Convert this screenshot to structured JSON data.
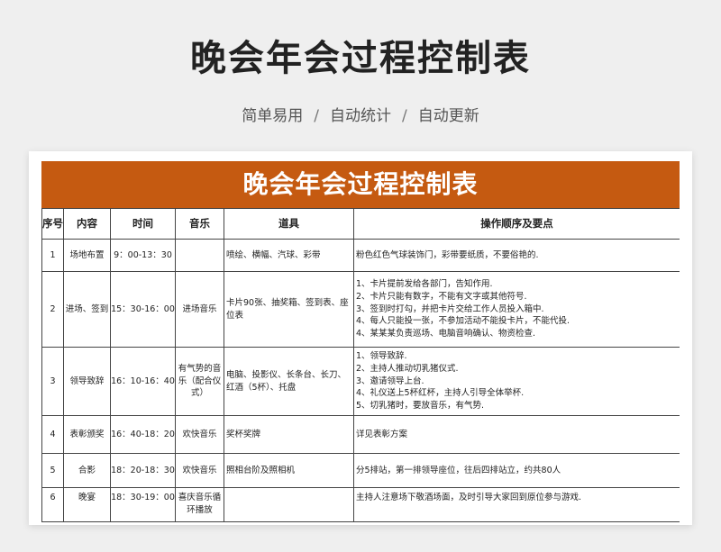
{
  "page": {
    "title": "晚会年会过程控制表",
    "subtitle": [
      "简单易用",
      "自动统计",
      "自动更新"
    ]
  },
  "sheet": {
    "banner": "晚会年会过程控制表",
    "headers": [
      "序号",
      "内容",
      "时间",
      "音乐",
      "道具",
      "操作顺序及要点"
    ],
    "rows": [
      {
        "no": "1",
        "content": "场地布置",
        "time": "9：00-13：30",
        "music": "",
        "props": "喷绘、横幅、汽球、彩带",
        "steps": [
          "粉色红色气球装饰门，彩带要纸质，不要俗艳的."
        ]
      },
      {
        "no": "2",
        "content": "进场、签到",
        "time": "15：30-16：00",
        "music": "进场音乐",
        "props": "卡片90张、抽奖箱、签到表、座位表",
        "steps": [
          "1、卡片提前发给各部门，告知作用.",
          "2、卡片只能有数字，不能有文字或其他符号.",
          "3、签到时打勾，并把卡片交给工作人员投入箱中.",
          "4、每人只能投一张，不参加活动不能投卡片，不能代投.",
          "4、某某某负责巡场、电脑音响确认、物资检查."
        ]
      },
      {
        "no": "3",
        "content": "领导致辞",
        "time": "16：10-16：40",
        "music": "有气势的音乐（配合仪式）",
        "props": "电脑、投影仪、长条台、长刀、红酒（5杯）、托盘",
        "steps": [
          "1、领导致辞.",
          "2、主持人推动切乳猪仪式.",
          "3、邀请领导上台.",
          "4、礼仪送上5杯红杯，主持人引导全体举杯.",
          "5、切乳猪时，要放音乐，有气势."
        ]
      },
      {
        "no": "4",
        "content": "表彰颁奖",
        "time": "16：40-18：20",
        "music": "欢快音乐",
        "props": "奖杯奖牌",
        "steps": [
          "详见表彰方案"
        ]
      },
      {
        "no": "5",
        "content": "合影",
        "time": "18：20-18：30",
        "music": "欢快音乐",
        "props": "照相台阶及照相机",
        "steps": [
          "分5排站，第一排领导座位，往后四排站立，约共80人"
        ]
      },
      {
        "no": "6",
        "content": "晚宴",
        "time": "18：30-19：00",
        "music": "喜庆音乐循环播放",
        "props": "",
        "steps": [
          "主持人注意场下敬酒场面，及时引导大家回到原位参与游戏."
        ]
      }
    ]
  }
}
